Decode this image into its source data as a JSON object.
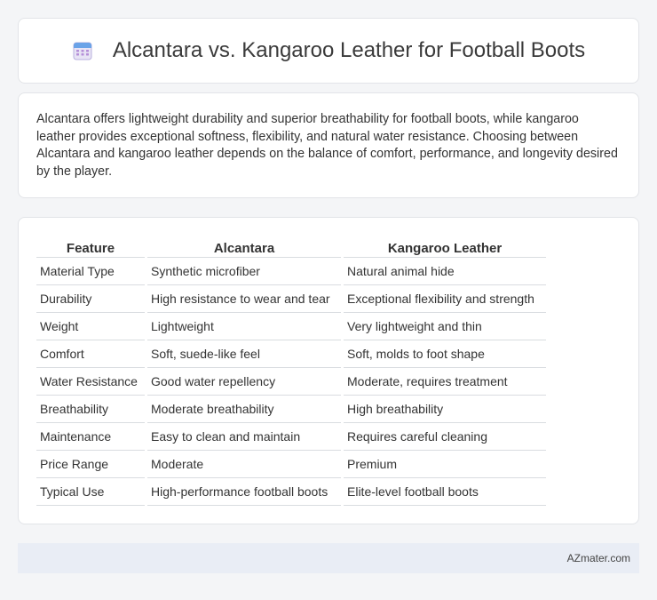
{
  "header": {
    "title": "Alcantara vs. Kangaroo Leather for Football Boots",
    "icon": "calendar-icon"
  },
  "summary": {
    "text": "Alcantara offers lightweight durability and superior breathability for football boots, while kangaroo leather provides exceptional softness, flexibility, and natural water resistance. Choosing between Alcantara and kangaroo leather depends on the balance of comfort, performance, and longevity desired by the player."
  },
  "table": {
    "headers": [
      "Feature",
      "Alcantara",
      "Kangaroo Leather"
    ],
    "rows": [
      [
        "Material Type",
        "Synthetic microfiber",
        "Natural animal hide"
      ],
      [
        "Durability",
        "High resistance to wear and tear",
        "Exceptional flexibility and strength"
      ],
      [
        "Weight",
        "Lightweight",
        "Very lightweight and thin"
      ],
      [
        "Comfort",
        "Soft, suede-like feel",
        "Soft, molds to foot shape"
      ],
      [
        "Water Resistance",
        "Good water repellency",
        "Moderate, requires treatment"
      ],
      [
        "Breathability",
        "Moderate breathability",
        "High breathability"
      ],
      [
        "Maintenance",
        "Easy to clean and maintain",
        "Requires careful cleaning"
      ],
      [
        "Price Range",
        "Moderate",
        "Premium"
      ],
      [
        "Typical Use",
        "High-performance football boots",
        "Elite-level football boots"
      ]
    ]
  },
  "footer": {
    "site": "AZmater.com"
  }
}
